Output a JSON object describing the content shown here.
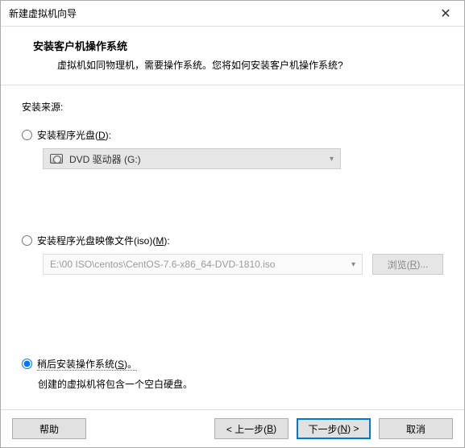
{
  "titlebar": {
    "title": "新建虚拟机向导",
    "close_glyph": "✕"
  },
  "header": {
    "title": "安装客户机操作系统",
    "desc": "虚拟机如同物理机，需要操作系统。您将如何安装客户机操作系统?"
  },
  "content": {
    "source_label": "安装来源:",
    "option_disc": {
      "label_pre": "安装程序光盘(",
      "mnemonic": "D",
      "label_post": "):",
      "combo_text": "DVD 驱动器 (G:)"
    },
    "option_iso": {
      "label_pre": "安装程序光盘映像文件(iso)(",
      "mnemonic": "M",
      "label_post": "):",
      "path": "E:\\00 ISO\\centos\\CentOS-7.6-x86_64-DVD-1810.iso",
      "browse_pre": "浏览(",
      "browse_mnemonic": "R",
      "browse_post": ")..."
    },
    "option_later": {
      "label_pre": "稍后安装操作系统(",
      "mnemonic": "S",
      "label_post": ")。",
      "desc": "创建的虚拟机将包含一个空白硬盘。"
    }
  },
  "footer": {
    "help": "帮助",
    "back_pre": "< 上一步(",
    "back_mnemonic": "B",
    "back_post": ")",
    "next_pre": "下一步(",
    "next_mnemonic": "N",
    "next_post": ") >",
    "cancel": "取消"
  }
}
